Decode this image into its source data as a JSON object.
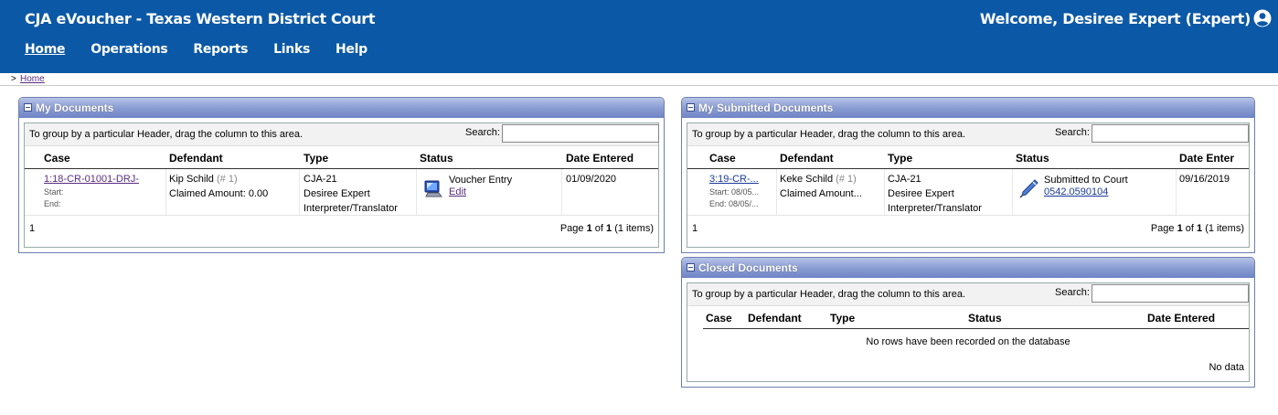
{
  "header": {
    "app_title": "CJA eVoucher - Texas Western District Court",
    "welcome": "Welcome, Desiree Expert (Expert)",
    "nav": [
      "Home",
      "Operations",
      "Reports",
      "Links",
      "Help"
    ]
  },
  "breadcrumb": {
    "sep": ">",
    "home": "Home"
  },
  "grid_common": {
    "group_hint": "To group by a particular Header, drag the column to this area.",
    "search_label": "Search:",
    "search_value": ""
  },
  "my_documents": {
    "title": "My Documents",
    "columns": [
      "Case",
      "Defendant",
      "Type",
      "Status",
      "Date Entered"
    ],
    "row": {
      "case": "1:18-CR-01001-DRJ-",
      "start_label": "Start:",
      "end_label": "End:",
      "defendant": "Kip Schild",
      "defendant_num": "(# 1)",
      "claimed": "Claimed Amount: 0.00",
      "type_line1": "CJA-21",
      "type_line2": "Desiree Expert",
      "type_line3": "Interpreter/Translator",
      "status": "Voucher Entry",
      "status_link": "Edit",
      "date": "01/09/2020"
    },
    "page_number": "1",
    "pager": {
      "pre": "Page",
      "cur": "1",
      "of": "of",
      "total": "1",
      "items": "(1 items)"
    }
  },
  "my_submitted": {
    "title": "My Submitted Documents",
    "columns": [
      "Case",
      "Defendant",
      "Type",
      "Status",
      "Date Enter"
    ],
    "row": {
      "case": "3:19-CR-...",
      "start": "Start: 08/05...",
      "end": "End: 08/05/...",
      "defendant": "Keke Schild",
      "defendant_num": "(# 1)",
      "claimed": "Claimed Amount...",
      "type_line1": "CJA-21",
      "type_line2": "Desiree Expert",
      "type_line3": "Interpreter/Translator",
      "status": "Submitted to Court",
      "status_link": "0542.0590104",
      "date": "09/16/2019"
    },
    "page_number": "1",
    "pager": {
      "pre": "Page",
      "cur": "1",
      "of": "of",
      "total": "1",
      "items": "(1 items)"
    }
  },
  "closed_documents": {
    "title": "Closed Documents",
    "columns": [
      "Case",
      "Defendant",
      "Type",
      "Status",
      "Date Entered"
    ],
    "empty_message": "No rows have been recorded on the database",
    "no_data": "No data"
  }
}
